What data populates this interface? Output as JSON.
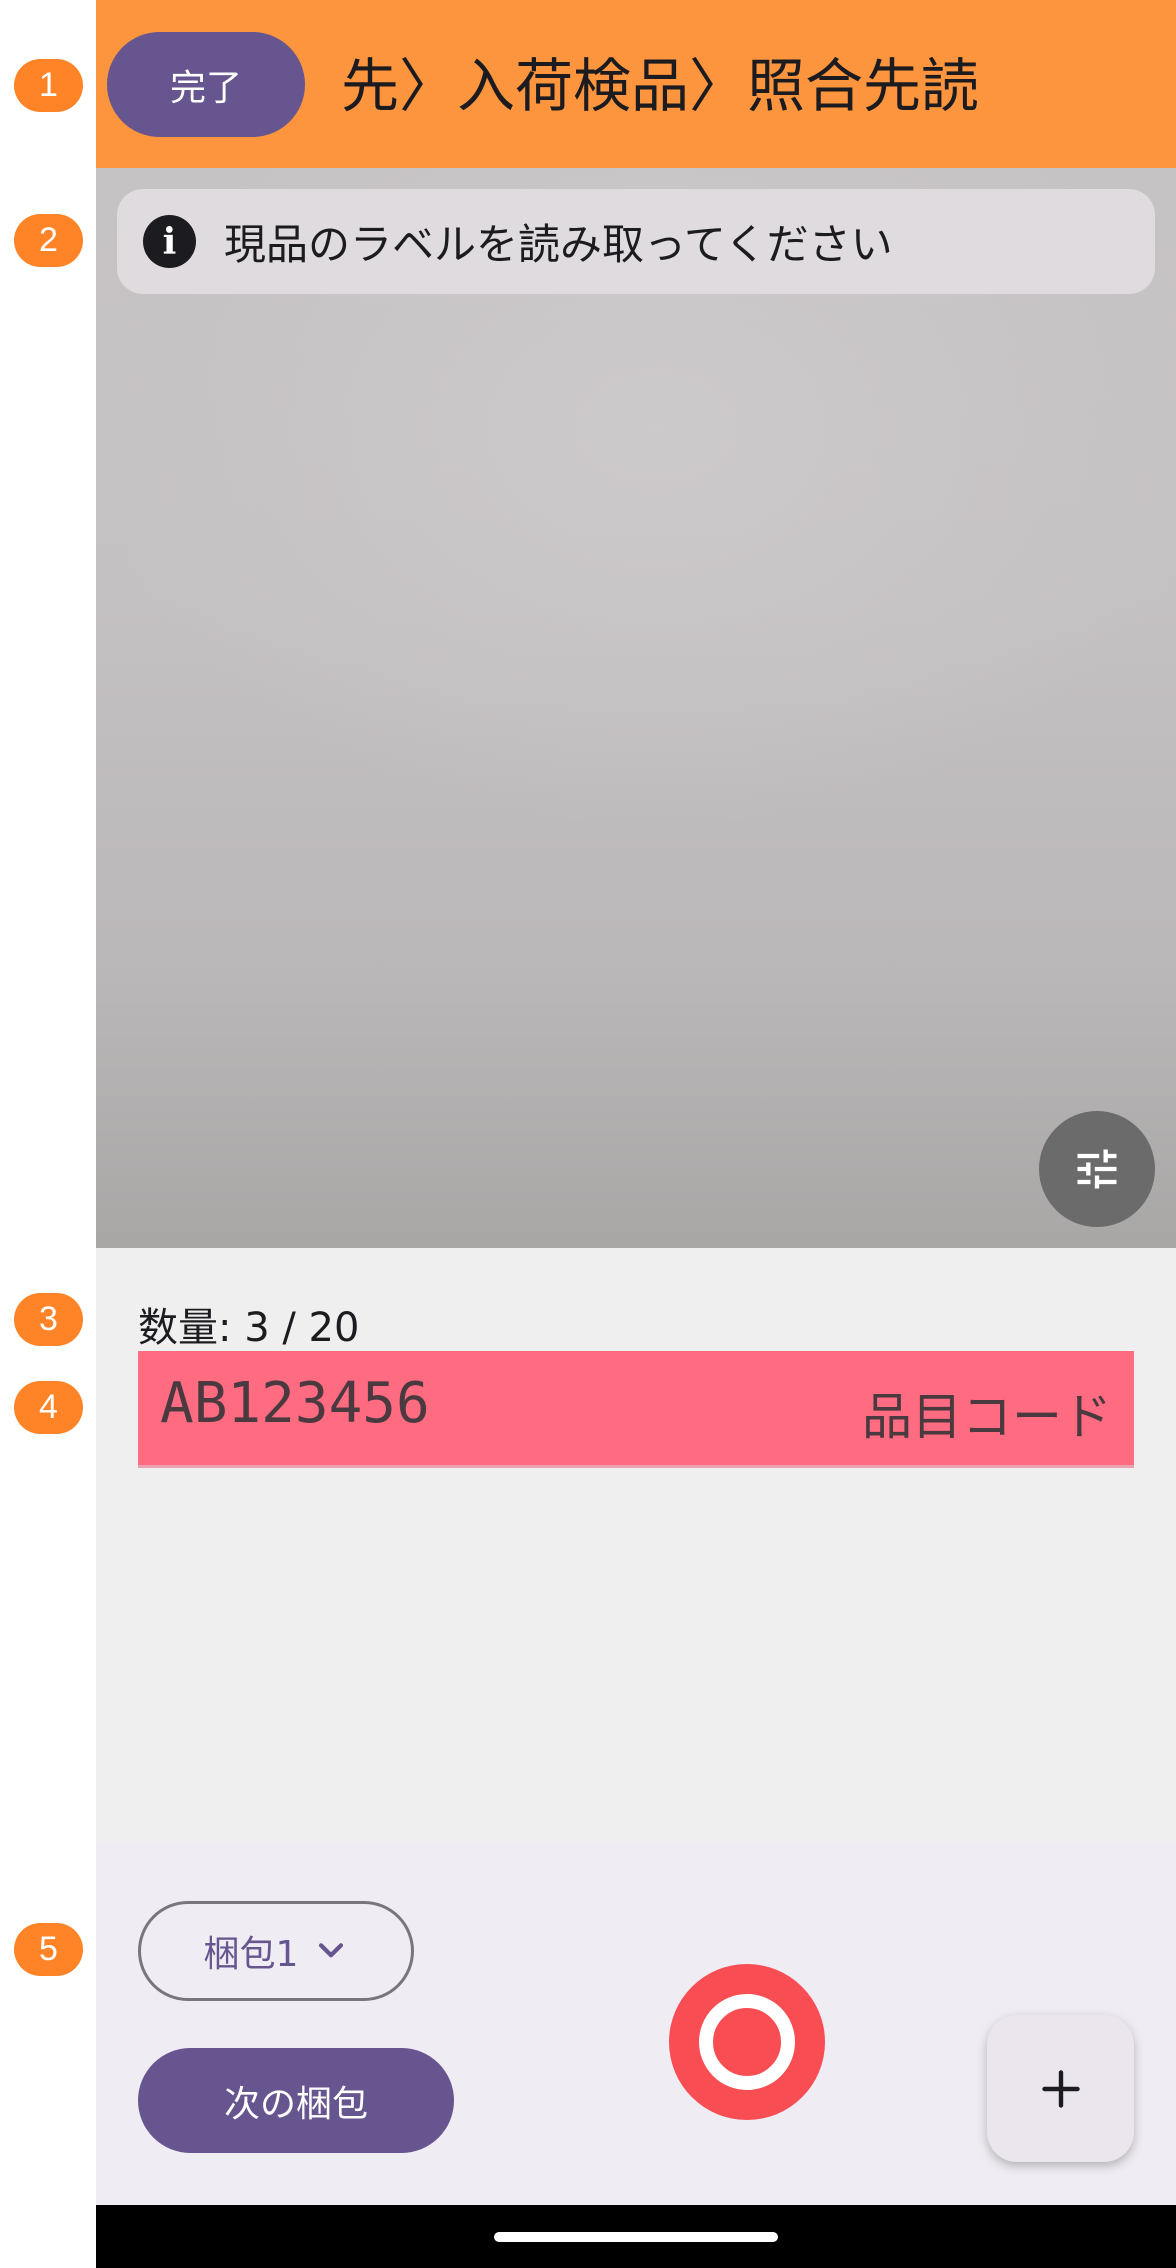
{
  "annotations": [
    "1",
    "2",
    "3",
    "4",
    "5"
  ],
  "app_bar": {
    "done_label": "完了",
    "breadcrumb": "先〉入荷検品〉照合先読"
  },
  "camera": {
    "banner_icon": "info-icon",
    "banner_text": "現品のラベルを読み取ってください",
    "settings_icon": "tune-icon"
  },
  "quantity": {
    "label": "数量: 3 / 20"
  },
  "code_field": {
    "value": "AB123456",
    "label": "品目コード"
  },
  "bottom": {
    "package_select": "梱包1",
    "dropdown_icon": "chevron-down-icon",
    "next_package_label": "次の梱包",
    "shutter_icon": "capture-icon",
    "add_icon": "plus-icon"
  },
  "colors": {
    "app_bar": "#fc953d",
    "primary": "#67558f",
    "code_field_bg": "#ff6b81",
    "shutter": "#f94d54",
    "marker": "#ff8327"
  }
}
